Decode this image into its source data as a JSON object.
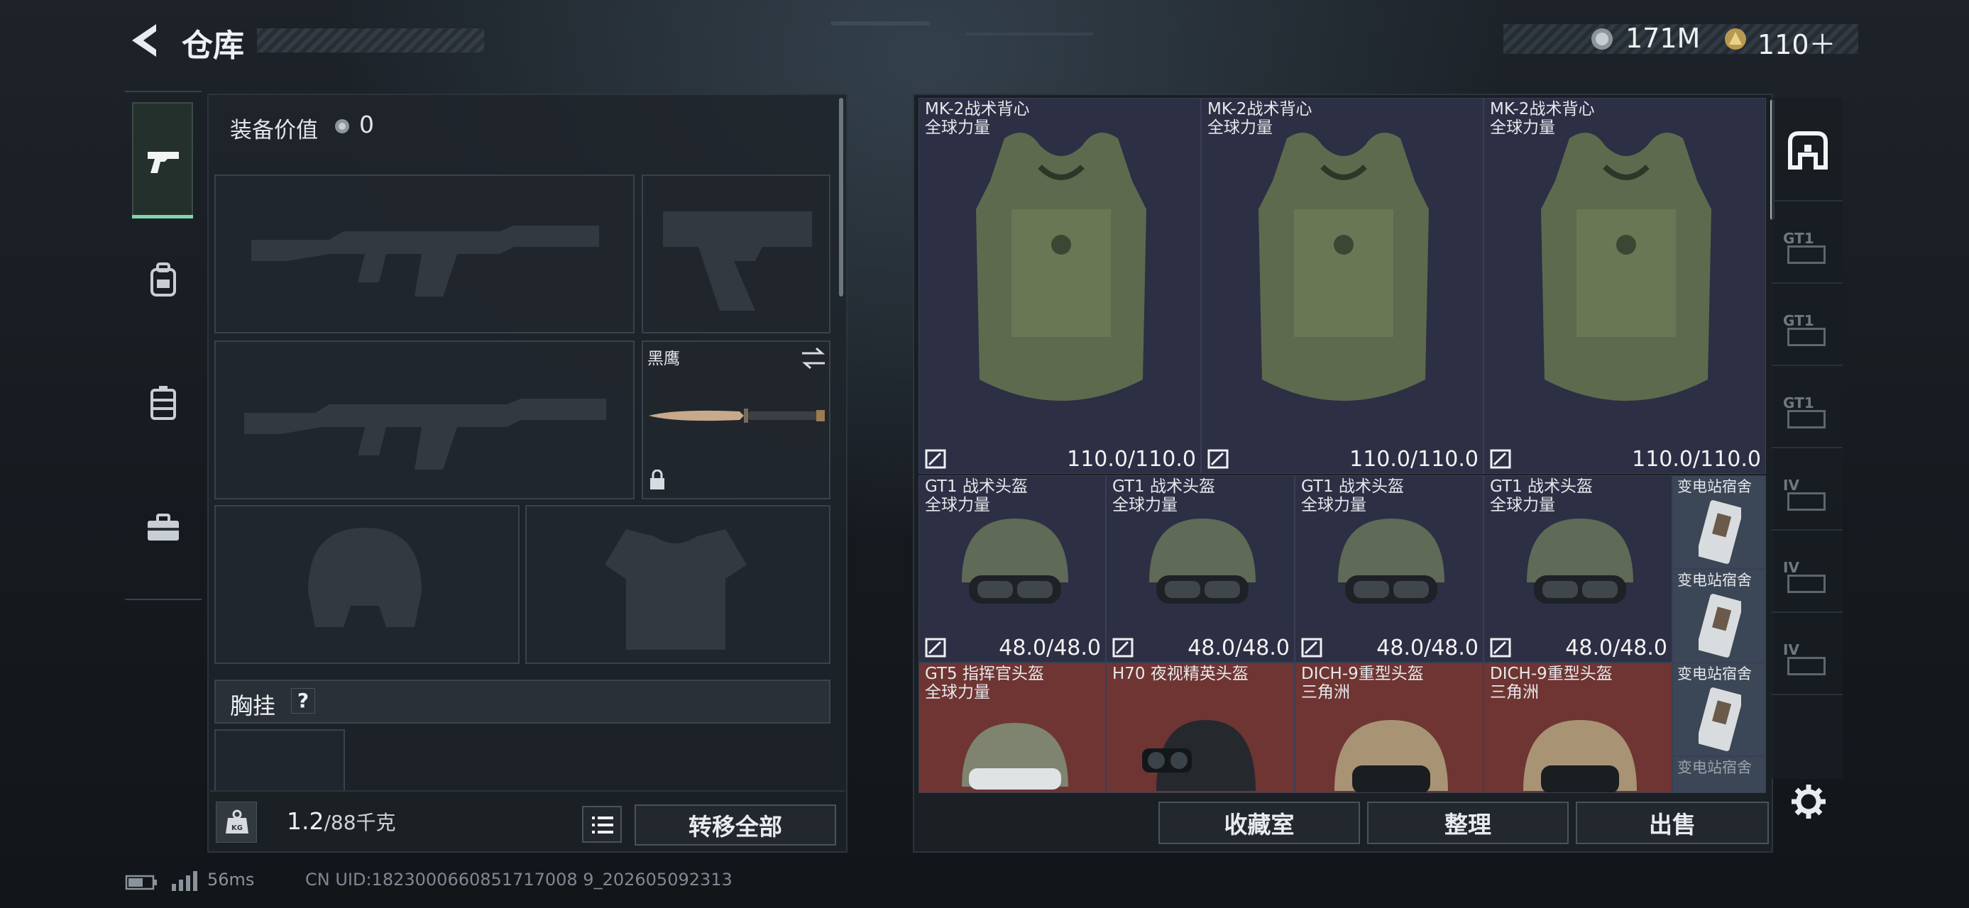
{
  "header": {
    "title": "仓库",
    "currency_a": "171M",
    "currency_b": "110＋"
  },
  "left_panel": {
    "equip_value_label": "装备价值",
    "equip_value": "0",
    "knife_name": "黑鹰",
    "chest_rig_label": "胸挂",
    "chest_rig_help": "?",
    "weight_value": "1.2",
    "weight_max": "/88千克",
    "transfer_all_label": "转移全部"
  },
  "inventory": {
    "vests": [
      {
        "name": "MK-2战术背心",
        "sub": "全球力量",
        "durability": "110.0/110.0"
      },
      {
        "name": "MK-2战术背心",
        "sub": "全球力量",
        "durability": "110.0/110.0"
      },
      {
        "name": "MK-2战术背心",
        "sub": "全球力量",
        "durability": "110.0/110.0"
      }
    ],
    "helmets": [
      {
        "name": "GT1 战术头盔",
        "sub": "全球力量",
        "durability": "48.0/48.0"
      },
      {
        "name": "GT1 战术头盔",
        "sub": "全球力量",
        "durability": "48.0/48.0"
      },
      {
        "name": "GT1 战术头盔",
        "sub": "全球力量",
        "durability": "48.0/48.0"
      },
      {
        "name": "GT1 战术头盔",
        "sub": "全球力量",
        "durability": "48.0/48.0"
      }
    ],
    "cards": [
      {
        "name": "变电站宿舍"
      },
      {
        "name": "变电站宿舍"
      },
      {
        "name": "变电站宿舍"
      },
      {
        "name": "变电站宿舍"
      }
    ],
    "helmets_row3": [
      {
        "name": "GT5 指挥官头盔",
        "sub": "全球力量"
      },
      {
        "name": "H70 夜视精英头盔",
        "sub": ""
      },
      {
        "name": "DICH-9重型头盔",
        "sub": "三角洲"
      },
      {
        "name": "DICH-9重型头盔",
        "sub": "三角洲"
      }
    ],
    "buttons": {
      "collection": "收藏室",
      "sort": "整理",
      "sell": "出售"
    }
  },
  "right_tabs": [
    "GT1",
    "GT1",
    "GT1",
    "IV",
    "IV",
    "IV"
  ],
  "footer": {
    "ping": "56ms",
    "uid": "CN UID:1823000660851717008 9_202605092313"
  },
  "colors": {
    "accent": "#7fd6a8",
    "vest_bg": "#2d2f44",
    "rare_bg": "#6e3533",
    "panel": "#1e242a"
  },
  "icons": [
    "back-arrow-icon",
    "coin-icon",
    "gold-coin-icon",
    "pistol-icon",
    "backpack-icon",
    "rig-icon",
    "toolbox-icon",
    "swap-icon",
    "lock-icon",
    "weight-icon",
    "list-icon",
    "repair-icon",
    "inventory-icon",
    "settings-gear-icon"
  ]
}
